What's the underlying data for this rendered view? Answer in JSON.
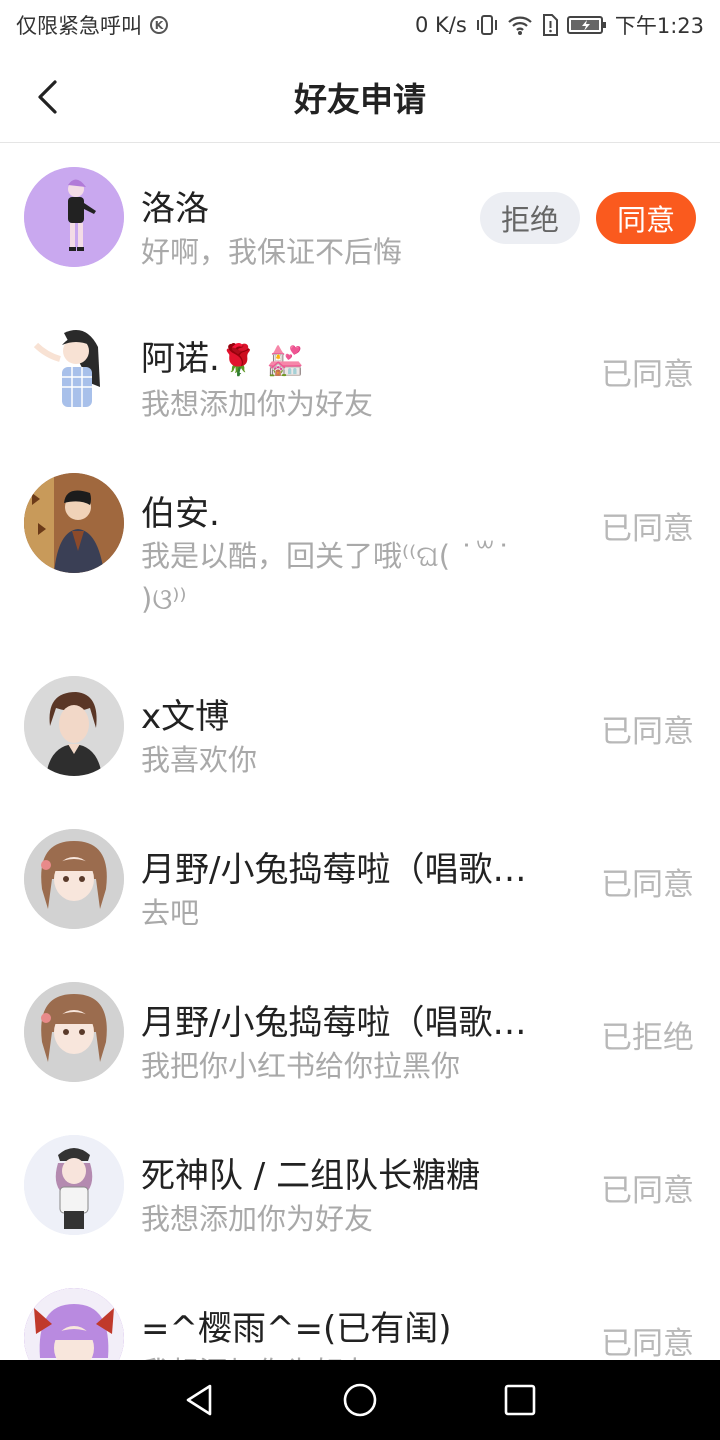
{
  "status_bar": {
    "carrier": "仅限紧急呼叫",
    "carrier_badge": "K",
    "speed": "0 K/s",
    "time": "下午1:23"
  },
  "header": {
    "title": "好友申请"
  },
  "requests": [
    {
      "name": "洛洛",
      "message": "好啊，我保证不后悔",
      "reject_label": "拒绝",
      "agree_label": "同意",
      "avatar_color": "#c9a8ef"
    },
    {
      "name": "阿诺.",
      "name_emoji": "🌹 💒",
      "message": "我想添加你为好友",
      "status": "已同意",
      "avatar_color": "#ffffff"
    },
    {
      "name": "伯安.",
      "message": "我是以酷，回关了哦⁽⁽ଘ( ˙꒳˙ )ଓ⁾⁾",
      "status": "已同意",
      "avatar_color": "#8a5a35"
    },
    {
      "name": "x文博",
      "message": "我喜欢你",
      "status": "已同意",
      "avatar_color": "#d6d6d6"
    },
    {
      "name": "月野/小兔捣莓啦（唱歌…",
      "message": "去吧",
      "status": "已同意",
      "avatar_color": "#cfcfcf"
    },
    {
      "name": "月野/小兔捣莓啦（唱歌…",
      "message": "我把你小红书给你拉黑你",
      "status": "已拒绝",
      "avatar_color": "#cfcfcf"
    },
    {
      "name": "死神队 / 二组队长糖糖",
      "message": "我想添加你为好友",
      "status": "已同意",
      "avatar_color": "#e6eaf5"
    },
    {
      "name": "=^樱雨^=(已有闺)",
      "message": "我想添加你为好友",
      "status": "已同意",
      "avatar_color": "#b98ae0"
    }
  ],
  "colors": {
    "accent": "#fa5a1e",
    "reject_bg": "#eceef3",
    "muted_text": "#a9a9a9"
  }
}
